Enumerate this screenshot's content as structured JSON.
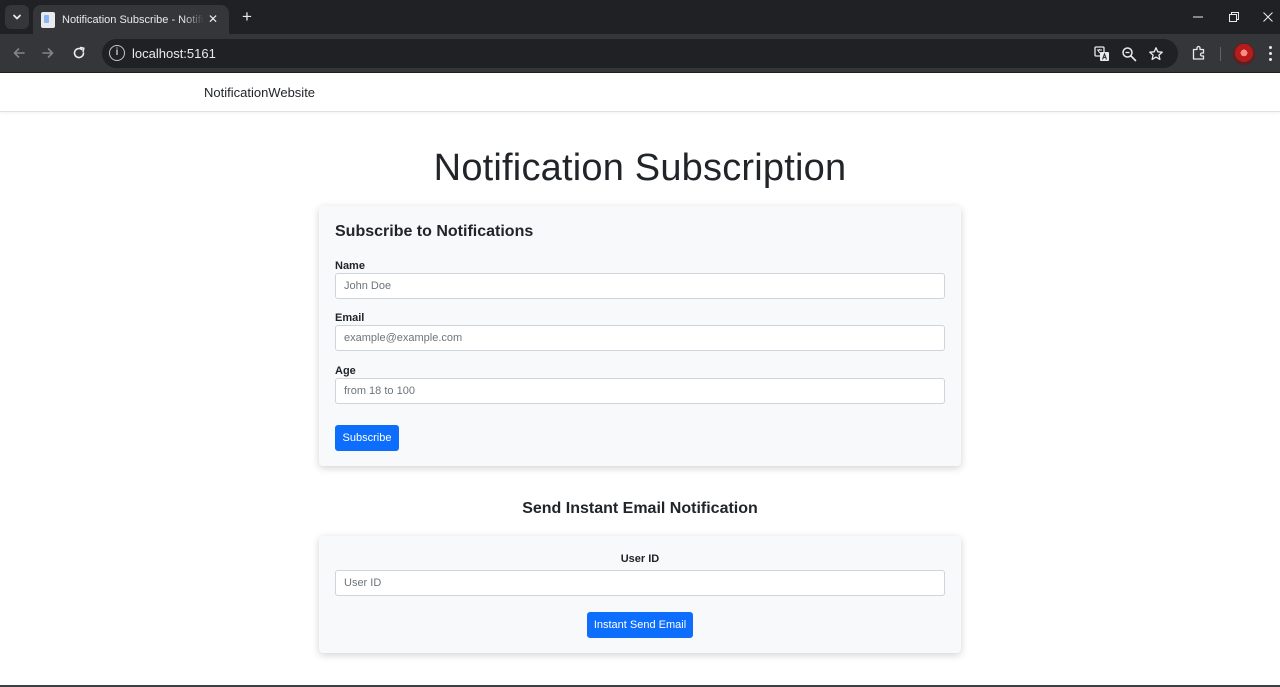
{
  "browser": {
    "tab_title": "Notification Subscribe - NotificationWebsite",
    "url": "localhost:5161",
    "new_tab_symbol": "+",
    "close_symbol": "✕",
    "info_symbol": "i"
  },
  "navbar": {
    "brand": "NotificationWebsite"
  },
  "page": {
    "title": "Notification Subscription"
  },
  "subscribe_form": {
    "title": "Subscribe to Notifications",
    "fields": [
      {
        "label": "Name",
        "placeholder": "John Doe",
        "value": ""
      },
      {
        "label": "Email",
        "placeholder": "example@example.com",
        "value": ""
      },
      {
        "label": "Age",
        "placeholder": "from 18 to 100",
        "value": ""
      }
    ],
    "submit_label": "Subscribe"
  },
  "instant_email": {
    "section_title": "Send Instant Email Notification",
    "user_id_label": "User ID",
    "user_id_placeholder": "User ID",
    "button_label": "Instant Send Email"
  },
  "colors": {
    "primary": "#0d6efd",
    "card_background": "#f8f9fa",
    "chrome_dark": "#202124",
    "chrome_toolbar": "#35363a"
  },
  "icons": {
    "tab_list": "chevron-down-icon",
    "back": "arrow-left-icon",
    "forward": "arrow-right-icon",
    "reload": "reload-icon",
    "translate": "translate-icon",
    "zoom": "zoom-icon",
    "bookmark": "star-icon",
    "extensions": "puzzle-icon",
    "profile": "avatar",
    "menu": "more-vertical-icon"
  }
}
